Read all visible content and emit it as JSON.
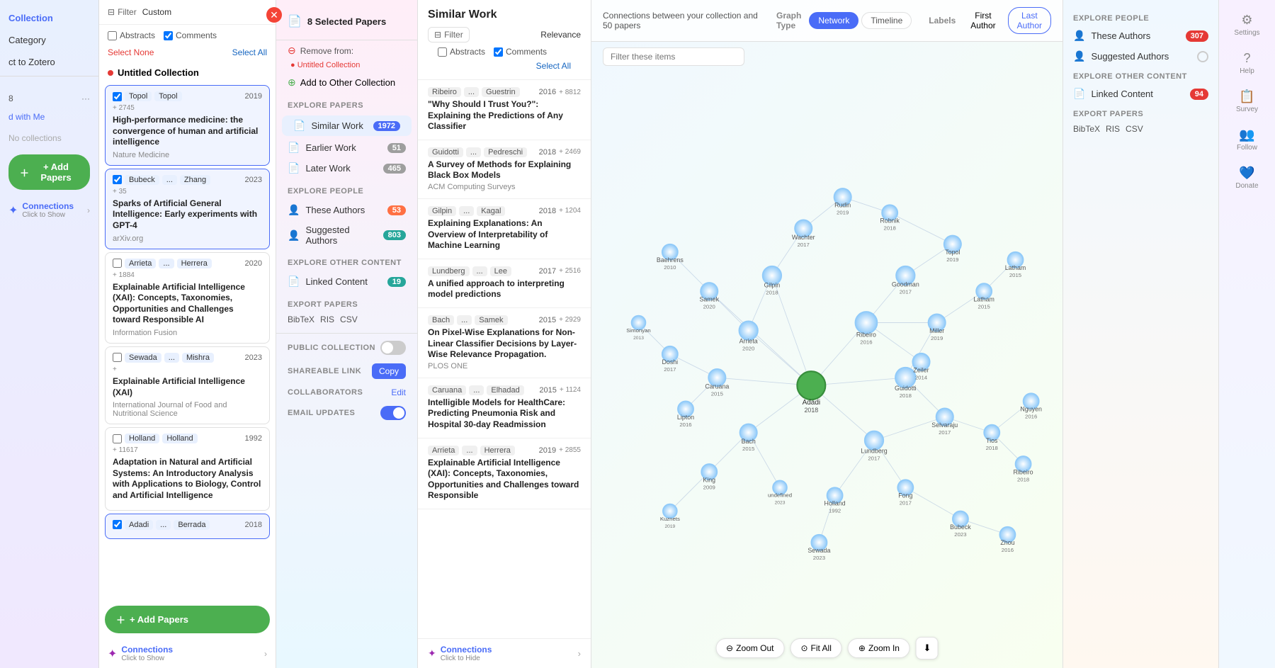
{
  "leftSidebar": {
    "items": [
      {
        "label": "Collection",
        "active": true
      },
      {
        "label": "Category"
      },
      {
        "label": "ct to Zotero"
      }
    ],
    "collection": {
      "name": "Untitled Collection",
      "badge": "8",
      "sharedWith": "d with Me",
      "noCollections": "No collections"
    },
    "addPapersBtn": "+ Add Papers",
    "connections": {
      "label": "Connections",
      "sub": "Click to Show"
    }
  },
  "filterPanel": {
    "filterLabel": "Filter",
    "customLabel": "Custom",
    "abstractsLabel": "Abstracts",
    "commentsLabel": "Comments",
    "selectNone": "Select None",
    "selectAll": "Select All",
    "collectionName": "Untitled Collection"
  },
  "papers": [
    {
      "authors": [
        "Topol",
        "Topol"
      ],
      "year": "2019",
      "citations": "+ 2745",
      "title": "High-performance medicine: the convergence of human and artificial intelligence",
      "journal": "Nature Medicine",
      "selected": true
    },
    {
      "authors": [
        "Bubeck",
        "...",
        "Zhang"
      ],
      "year": "2023",
      "citations": "+ 35",
      "title": "Sparks of Artificial General Intelligence: Early experiments with GPT-4",
      "journal": "arXiv.org",
      "selected": true
    },
    {
      "authors": [
        "Arrieta",
        "...",
        "Herrera"
      ],
      "year": "2020",
      "citations": "+ 1884",
      "title": "Explainable Artificial Intelligence (XAI): Concepts, Taxonomies, Opportunities and Challenges toward Responsible AI",
      "journal": "Information Fusion",
      "selected": false
    },
    {
      "authors": [
        "Sewada",
        "...",
        "Mishra"
      ],
      "year": "2023",
      "citations": "+",
      "title": "Explainable Artificial Intelligence (XAI)",
      "journal": "International Journal of Food and Nutritional Science",
      "selected": false
    },
    {
      "authors": [
        "Holland",
        "Holland"
      ],
      "year": "1992",
      "citations": "+ 11617",
      "title": "Adaptation in Natural and Artificial Systems: An Introductory Analysis with Applications to Biology, Control and Artificial Intelligence",
      "journal": "",
      "selected": false
    },
    {
      "authors": [
        "Adadi",
        "...",
        "Berrada"
      ],
      "year": "2018",
      "citations": "",
      "title": "",
      "journal": "",
      "selected": true
    }
  ],
  "explorePanel": {
    "selectedPapers": "8 Selected Papers",
    "removeFrom": "Remove from:",
    "removeCollection": "Untitled Collection",
    "addOther": "Add to Other Collection",
    "sections": {
      "explorePapers": "EXPLORE PAPERS",
      "explorePeople": "EXPLORE PEOPLE",
      "exploreOtherContent": "EXPLORE OTHER CONTENT",
      "exportPapers": "EXPORT PAPERS"
    },
    "similarWork": {
      "label": "Similar Work",
      "count": "1972"
    },
    "earlierWork": {
      "label": "Earlier Work",
      "count": "51"
    },
    "laterWork": {
      "label": "Later Work",
      "count": "465"
    },
    "theseAuthors": {
      "label": "These Authors",
      "count": "53"
    },
    "suggestedAuthors": {
      "label": "Suggested Authors",
      "count": "803"
    },
    "linkedContent": {
      "label": "Linked Content",
      "count": "19"
    },
    "export": {
      "bibtex": "BibTeX",
      "ris": "RIS",
      "csv": "CSV"
    },
    "publicCollection": "PUBLIC COLLECTION",
    "shareableLink": "SHAREABLE LINK",
    "collaborators": "COLLABORATORS",
    "emailUpdates": "EMAIL UPDATES",
    "copyBtn": "Copy",
    "editBtn": "Edit"
  },
  "similarPanel": {
    "title": "Similar Work",
    "filterLabel": "Filter",
    "relevanceLabel": "Relevance",
    "abstractsLabel": "Abstracts",
    "commentsLabel": "Comments",
    "selectAll": "Select All",
    "papers": [
      {
        "authors": [
          "Ribeiro",
          "...",
          "Guestrin"
        ],
        "year": "2016",
        "citations": "+ 8812",
        "title": "\"Why Should I Trust You?\": Explaining the Predictions of Any Classifier",
        "journal": ""
      },
      {
        "authors": [
          "Guidotti",
          "...",
          "Pedreschi"
        ],
        "year": "2018",
        "citations": "+ 2469",
        "title": "A Survey of Methods for Explaining Black Box Models",
        "journal": "ACM Computing Surveys"
      },
      {
        "authors": [
          "Gilpin",
          "...",
          "Kagal"
        ],
        "year": "2018",
        "citations": "+ 1204",
        "title": "Explaining Explanations: An Overview of Interpretability of Machine Learning",
        "journal": ""
      },
      {
        "authors": [
          "Lundberg",
          "...",
          "Lee"
        ],
        "year": "2017",
        "citations": "+ 2516",
        "title": "A unified approach to interpreting model predictions",
        "journal": ""
      },
      {
        "authors": [
          "Bach",
          "...",
          "Samek"
        ],
        "year": "2015",
        "citations": "+ 2929",
        "title": "On Pixel-Wise Explanations for Non-Linear Classifier Decisions by Layer-Wise Relevance Propagation.",
        "journal": "PLOS ONE"
      },
      {
        "authors": [
          "Caruana",
          "...",
          "Elhadad"
        ],
        "year": "2015",
        "citations": "+ 1124",
        "title": "Intelligible Models for HealthCare: Predicting Pneumonia Risk and Hospital 30-day Readmission",
        "journal": ""
      },
      {
        "authors": [
          "Arrieta",
          "...",
          "Herrera"
        ],
        "year": "2019",
        "citations": "+ 2855",
        "title": "Explainable Artificial Intelligence (XAI): Concepts, Taxonomies, Opportunities and Challenges toward Responsible",
        "journal": ""
      }
    ],
    "connections": {
      "label": "Connections",
      "sub": "Click to Hide"
    }
  },
  "networkPanel": {
    "info": "Connections between your collection and 50 papers",
    "graphTypeLabel": "Graph Type",
    "labelsLabel": "Labels",
    "graphTypes": [
      "Network",
      "Timeline"
    ],
    "labels": [
      "First Author",
      "Last Author"
    ],
    "activeGraphType": "Network",
    "activeLabel": "Last Author",
    "filterPlaceholder": "Filter these items",
    "controls": {
      "zoomOut": "Zoom Out",
      "fitAll": "Fit All",
      "zoomIn": "Zoom In"
    }
  },
  "rightPanel": {
    "explorePeople": "EXPLORE PEOPLE",
    "exploreOtherContent": "EXPLORE OTHER CONTENT",
    "exportPapers": "EXPORT PAPERS",
    "theseAuthors": {
      "label": "These Authors",
      "count": "307"
    },
    "suggestedAuthors": {
      "label": "Suggested Authors",
      "count": ""
    },
    "linkedContent": {
      "label": "Linked Content",
      "count": "94"
    },
    "export": {
      "bibtex": "BibTeX",
      "ris": "RIS",
      "csv": "CSV"
    },
    "sidebarItems": [
      {
        "label": "Settings",
        "icon": "⚙"
      },
      {
        "label": "Help",
        "icon": "?"
      },
      {
        "label": "Survey",
        "icon": "📋"
      },
      {
        "label": "Follow",
        "icon": "👥"
      },
      {
        "label": "Donate",
        "icon": "💙"
      }
    ]
  }
}
